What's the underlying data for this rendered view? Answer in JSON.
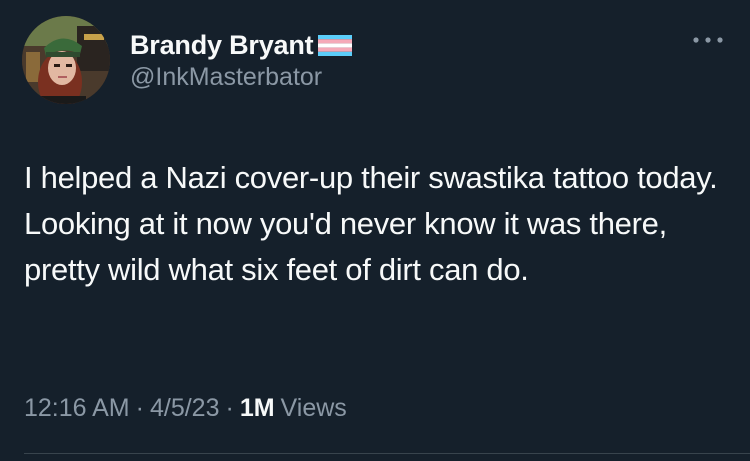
{
  "author": {
    "display_name": "Brandy Bryant",
    "handle": "@InkMasterbator",
    "avatar_icon": "user-avatar-photo",
    "badge_icon": "transgender-flag-icon",
    "flag_colors": [
      "#5bcefa",
      "#f5a9b8",
      "#ffffff",
      "#f5a9b8",
      "#5bcefa"
    ]
  },
  "menu": {
    "icon": "more-options-icon"
  },
  "tweet": {
    "text": "I helped a Nazi cover-up their swastika tattoo today. Looking at it now you'd never know it was there, pretty wild what six feet of dirt can do."
  },
  "meta": {
    "time": "12:16 AM",
    "separator": "·",
    "date": "4/5/23",
    "views_count": "1M",
    "views_label": "Views"
  },
  "colors": {
    "background": "#15202b",
    "primary_text": "#f7f9f9",
    "secondary_text": "#8b98a5",
    "divider": "#38444d"
  }
}
